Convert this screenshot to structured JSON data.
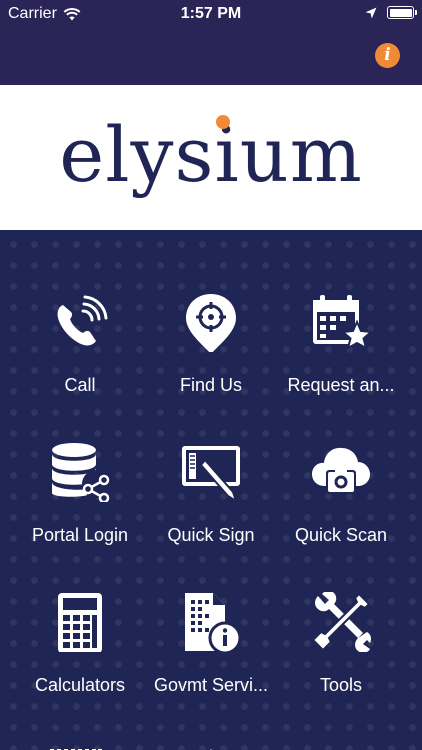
{
  "status_bar": {
    "carrier": "Carrier",
    "time": "1:57 PM"
  },
  "nav": {
    "info_icon": "i"
  },
  "logo": {
    "text": "elysium"
  },
  "tiles": [
    {
      "label": "Call",
      "icon": "phone-icon"
    },
    {
      "label": "Find Us",
      "icon": "location-pin-icon"
    },
    {
      "label": "Request an...",
      "icon": "calendar-star-icon"
    },
    {
      "label": "Portal Login",
      "icon": "database-share-icon"
    },
    {
      "label": "Quick Sign",
      "icon": "sign-tablet-icon"
    },
    {
      "label": "Quick Scan",
      "icon": "cloud-camera-icon"
    },
    {
      "label": "Calculators",
      "icon": "calculator-icon"
    },
    {
      "label": "Govmt Servi...",
      "icon": "document-info-icon"
    },
    {
      "label": "Tools",
      "icon": "tools-icon"
    }
  ],
  "colors": {
    "header_bg": "#2b2456",
    "main_bg": "#1f2554",
    "accent": "#f08a37",
    "logo_text": "#1f2554"
  }
}
